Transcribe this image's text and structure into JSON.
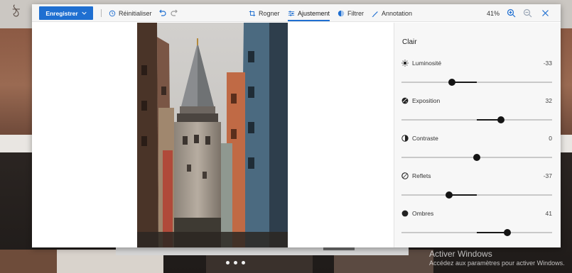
{
  "toolbar": {
    "save_label": "Enregistrer",
    "reset_label": "Réinitialiser",
    "tabs": [
      {
        "label": "Rogner",
        "icon": "crop-icon"
      },
      {
        "label": "Ajustement",
        "icon": "adjust-icon",
        "active": true
      },
      {
        "label": "Filtrer",
        "icon": "filter-icon"
      },
      {
        "label": "Annotation",
        "icon": "pen-icon"
      }
    ],
    "zoom": "41%"
  },
  "panel": {
    "title": "Clair",
    "adjustments": [
      {
        "label": "Luminosité",
        "value": "-33",
        "level": -33,
        "icon": "sun-icon"
      },
      {
        "label": "Exposition",
        "value": "32",
        "level": 32,
        "icon": "exposure-icon"
      },
      {
        "label": "Contraste",
        "value": "0",
        "level": 0,
        "icon": "contrast-icon"
      },
      {
        "label": "Reflets",
        "value": "-37",
        "level": -37,
        "icon": "highlights-icon"
      },
      {
        "label": "Ombres",
        "value": "41",
        "level": 41,
        "icon": "shadows-icon"
      }
    ]
  },
  "background": {
    "watermark_title": "Activer Windows",
    "watermark_sub": "Accédez aux paramètres pour activer Windows."
  },
  "colors": {
    "accent": "#1f6fd1",
    "slider_fill": "#1a1a1a"
  }
}
